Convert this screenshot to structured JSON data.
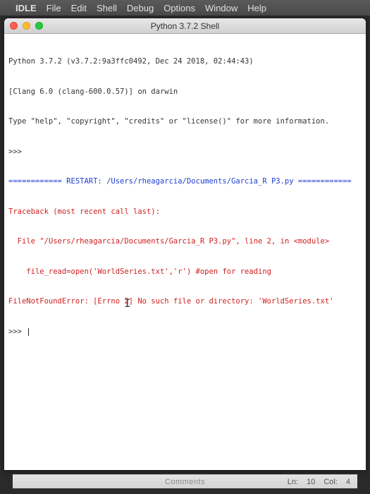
{
  "menubar": {
    "app": "IDLE",
    "items": [
      "File",
      "Edit",
      "Shell",
      "Debug",
      "Options",
      "Window",
      "Help"
    ]
  },
  "window": {
    "title": "Python 3.7.2 Shell"
  },
  "shell": {
    "banner1": "Python 3.7.2 (v3.7.2:9a3ffc0492, Dec 24 2018, 02:44:43)",
    "banner2": "[Clang 6.0 (clang-600.0.57)] on darwin",
    "banner3": "Type \"help\", \"copyright\", \"credits\" or \"license()\" for more information.",
    "prompt1": ">>>",
    "restart_line": "============ RESTART: /Users/rheagarcia/Documents/Garcia_R P3.py ============",
    "tb1": "Traceback (most recent call last):",
    "tb2": "  File \"/Users/rheagarcia/Documents/Garcia_R P3.py\", line 2, in <module>",
    "tb3": "    file_read=open('WorldSeries.txt','r') #open for reading",
    "tb4": "FileNotFoundError: [Errno 2] No such file or directory: 'WorldSeries.txt'",
    "prompt2": ">>> "
  },
  "statusbar": {
    "left_label": "Comments",
    "ln_label": "Ln:",
    "ln_value": "10",
    "col_label": "Col:",
    "col_value": "4"
  },
  "glyphs": {
    "apple": "",
    "text_cursor": "I"
  }
}
